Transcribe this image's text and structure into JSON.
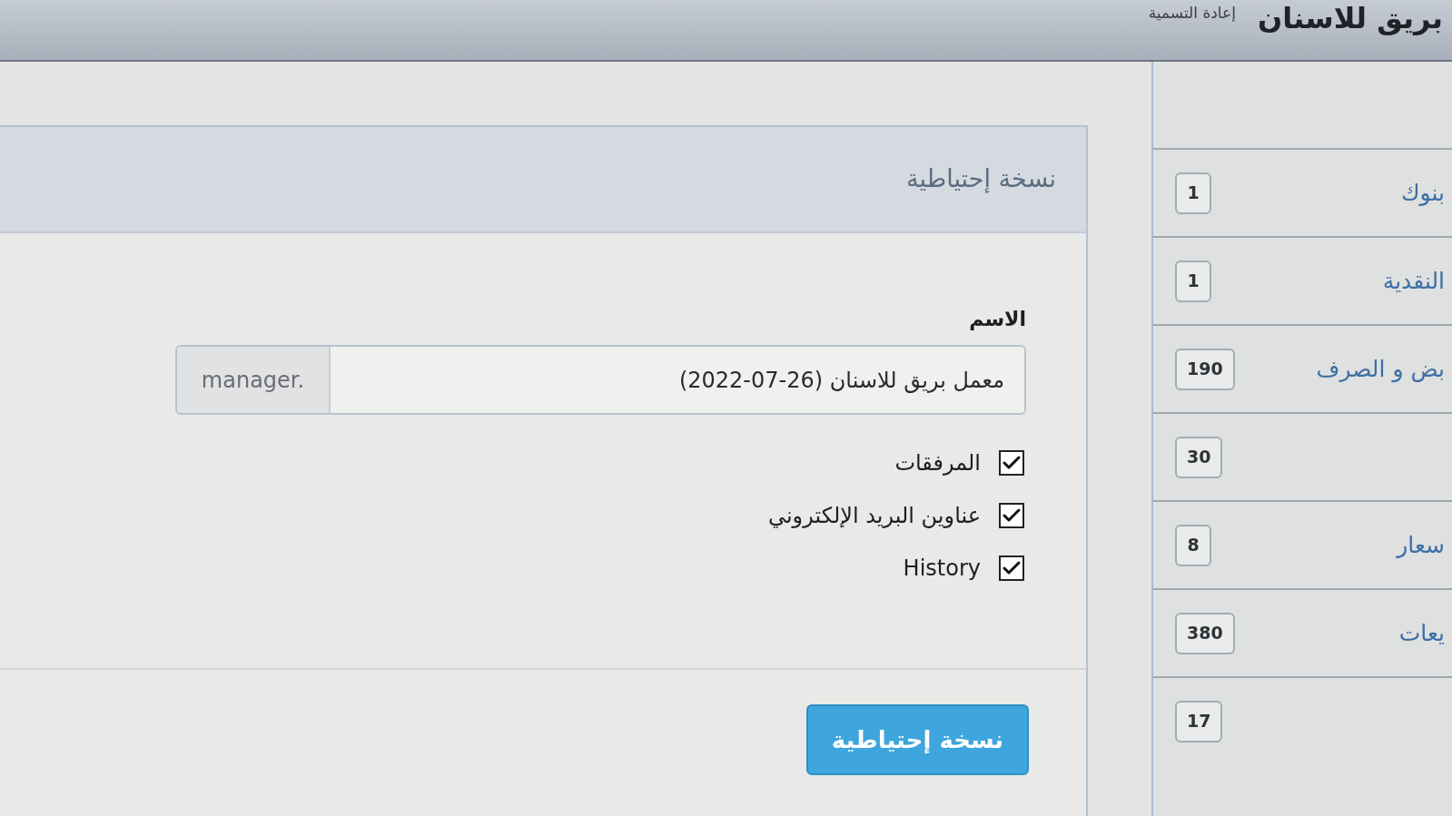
{
  "header": {
    "title": "بريق للاسنان",
    "rename_link": "إعادة التسمية"
  },
  "backup_panel": {
    "title": "نسخة إحتياطية",
    "name_label": "الاسم",
    "name_field": {
      "value": "معمل بريق للاسنان",
      "date": "(2022-07-26)",
      "suffix": "manager."
    },
    "options": [
      {
        "label": "المرفقات",
        "checked": true
      },
      {
        "label": "عناوين البريد الإلكتروني",
        "checked": true
      },
      {
        "label": "History",
        "checked": true
      }
    ],
    "submit_button": "نسخة إحتياطية"
  },
  "sidebar": {
    "items": [
      {
        "label": "بنوك",
        "count": "1"
      },
      {
        "label": "النقدية",
        "count": "1"
      },
      {
        "label": "بض و الصرف",
        "count": "190"
      },
      {
        "count": "30"
      },
      {
        "label": "سعار",
        "count": "8"
      },
      {
        "label": "يعات",
        "count": "380"
      },
      {
        "count": "17"
      }
    ]
  }
}
